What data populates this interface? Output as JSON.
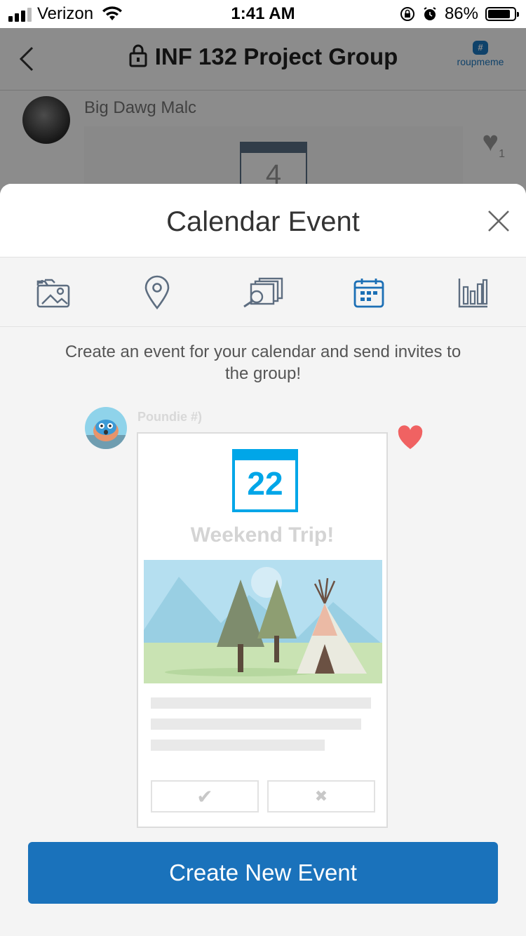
{
  "status_bar": {
    "carrier": "Verizon",
    "time": "1:41 AM",
    "battery_percent": "86%",
    "battery_level": 0.86
  },
  "background_chat": {
    "group_title": "INF 132 Project Group",
    "brand_text": "roupmeme",
    "message_author": "Big Dawg Malc",
    "calendar_day": "4",
    "like_count": "1"
  },
  "modal": {
    "title": "Calendar Event",
    "toolbar": [
      {
        "name": "image-attach",
        "icon": "image-icon"
      },
      {
        "name": "location",
        "icon": "location-pin-icon"
      },
      {
        "name": "search-gallery",
        "icon": "search-stack-icon"
      },
      {
        "name": "calendar-event",
        "icon": "calendar-icon",
        "active": true
      },
      {
        "name": "poll",
        "icon": "bar-chart-icon"
      }
    ],
    "prompt": "Create an event for your calendar and send invites to the group!",
    "preview": {
      "author": "Poundie #)",
      "calendar_day": "22",
      "event_title": "Weekend Trip!",
      "accept_symbol": "✔",
      "decline_symbol": "✖"
    },
    "create_button": "Create New Event"
  },
  "colors": {
    "accent_blue": "#1a72bb",
    "calendar_blue": "#00a6e8",
    "heart_red": "#f06262",
    "active_icon": "#1c6fb5",
    "inactive_icon": "#5d6d80"
  }
}
